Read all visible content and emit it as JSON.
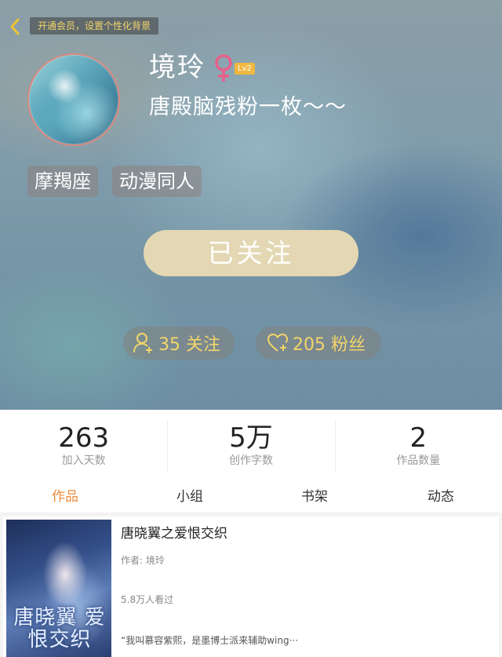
{
  "header": {
    "back_icon": "chevron-left-icon",
    "promo_banner": "开通会员，设置个性化背景",
    "username": "境玲",
    "gender_icon": "female-symbol-icon",
    "level": "Lv2",
    "signature": "唐殿脑残粉一枚～～",
    "tags": [
      "摩羯座",
      "动漫同人"
    ],
    "follow_button": "已关注",
    "following_icon": "user-plus-icon",
    "following_label": "35 关注",
    "fans_icon": "heart-plus-icon",
    "fans_label": "205 粉丝"
  },
  "stats": [
    {
      "value": "263",
      "label": "加入天数"
    },
    {
      "value": "5万",
      "label": "创作字数"
    },
    {
      "value": "2",
      "label": "作品数量"
    }
  ],
  "tabs": [
    {
      "label": "作品",
      "active": true
    },
    {
      "label": "小组",
      "active": false
    },
    {
      "label": "书架",
      "active": false
    },
    {
      "label": "动态",
      "active": false
    }
  ],
  "book": {
    "cover_title": "唐晓翼 爱恨交织",
    "title": "唐晓翼之爱恨交织",
    "author": "作者: 境玲",
    "views": "5.8万人看过",
    "excerpt": "“我叫慕容紫熙，是墨博士派来辅助wing···"
  },
  "colors": {
    "accent": "#f08c3c",
    "gold_text": "#f2d56a",
    "level_badge": "#f0b840",
    "follow_button": "#e3d8b3"
  }
}
